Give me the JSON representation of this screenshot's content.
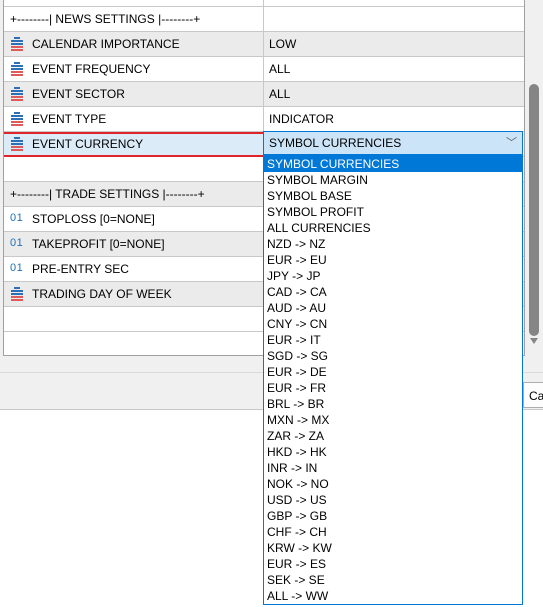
{
  "news_section": {
    "header": "+--------| NEWS SETTINGS |--------+",
    "rows": [
      {
        "icon": "enum-icon",
        "label": "CALENDAR IMPORTANCE",
        "value": "LOW"
      },
      {
        "icon": "enum-icon",
        "label": "EVENT FREQUENCY",
        "value": "ALL"
      },
      {
        "icon": "enum-icon",
        "label": "EVENT SECTOR",
        "value": "ALL"
      },
      {
        "icon": "enum-icon",
        "label": "EVENT TYPE",
        "value": "INDICATOR"
      },
      {
        "icon": "enum-icon",
        "label": "EVENT CURRENCY",
        "value": "SYMBOL CURRENCIES"
      }
    ]
  },
  "trade_section": {
    "header": "+--------| TRADE SETTINGS |--------+",
    "rows": [
      {
        "icon": "numeric-icon",
        "icon_text": "01",
        "label": "STOPLOSS [0=NONE]",
        "value": ""
      },
      {
        "icon": "numeric-icon",
        "icon_text": "01",
        "label": "TAKEPROFIT [0=NONE]",
        "value": ""
      },
      {
        "icon": "numeric-icon",
        "icon_text": "01",
        "label": "PRE-ENTRY SEC",
        "value": ""
      },
      {
        "icon": "enum-icon",
        "label": "TRADING DAY OF WEEK",
        "value": ""
      }
    ]
  },
  "combo": {
    "selected": "SYMBOL CURRENCIES",
    "chevron": "﹀"
  },
  "dropdown_options": [
    "SYMBOL CURRENCIES",
    "SYMBOL MARGIN",
    "SYMBOL BASE",
    "SYMBOL PROFIT",
    "ALL CURRENCIES",
    "NZD -> NZ",
    "EUR -> EU",
    "JPY -> JP",
    "CAD -> CA",
    "AUD -> AU",
    "CNY -> CN",
    "EUR -> IT",
    "SGD -> SG",
    "EUR -> DE",
    "EUR -> FR",
    "BRL -> BR",
    "MXN -> MX",
    "ZAR -> ZA",
    "HKD -> HK",
    "INR -> IN",
    "NOK -> NO",
    "USD -> US",
    "GBP -> GB",
    "CHF -> CH",
    "KRW -> KW",
    "EUR -> ES",
    "SEK -> SE",
    "ALL -> WW"
  ],
  "cancel_button": "Ca",
  "colors": {
    "accent": "#0078d7",
    "highlight_border": "#e0242b",
    "enum_icon_blue": "#2c6fb7",
    "enum_icon_red": "#e05a5a"
  }
}
